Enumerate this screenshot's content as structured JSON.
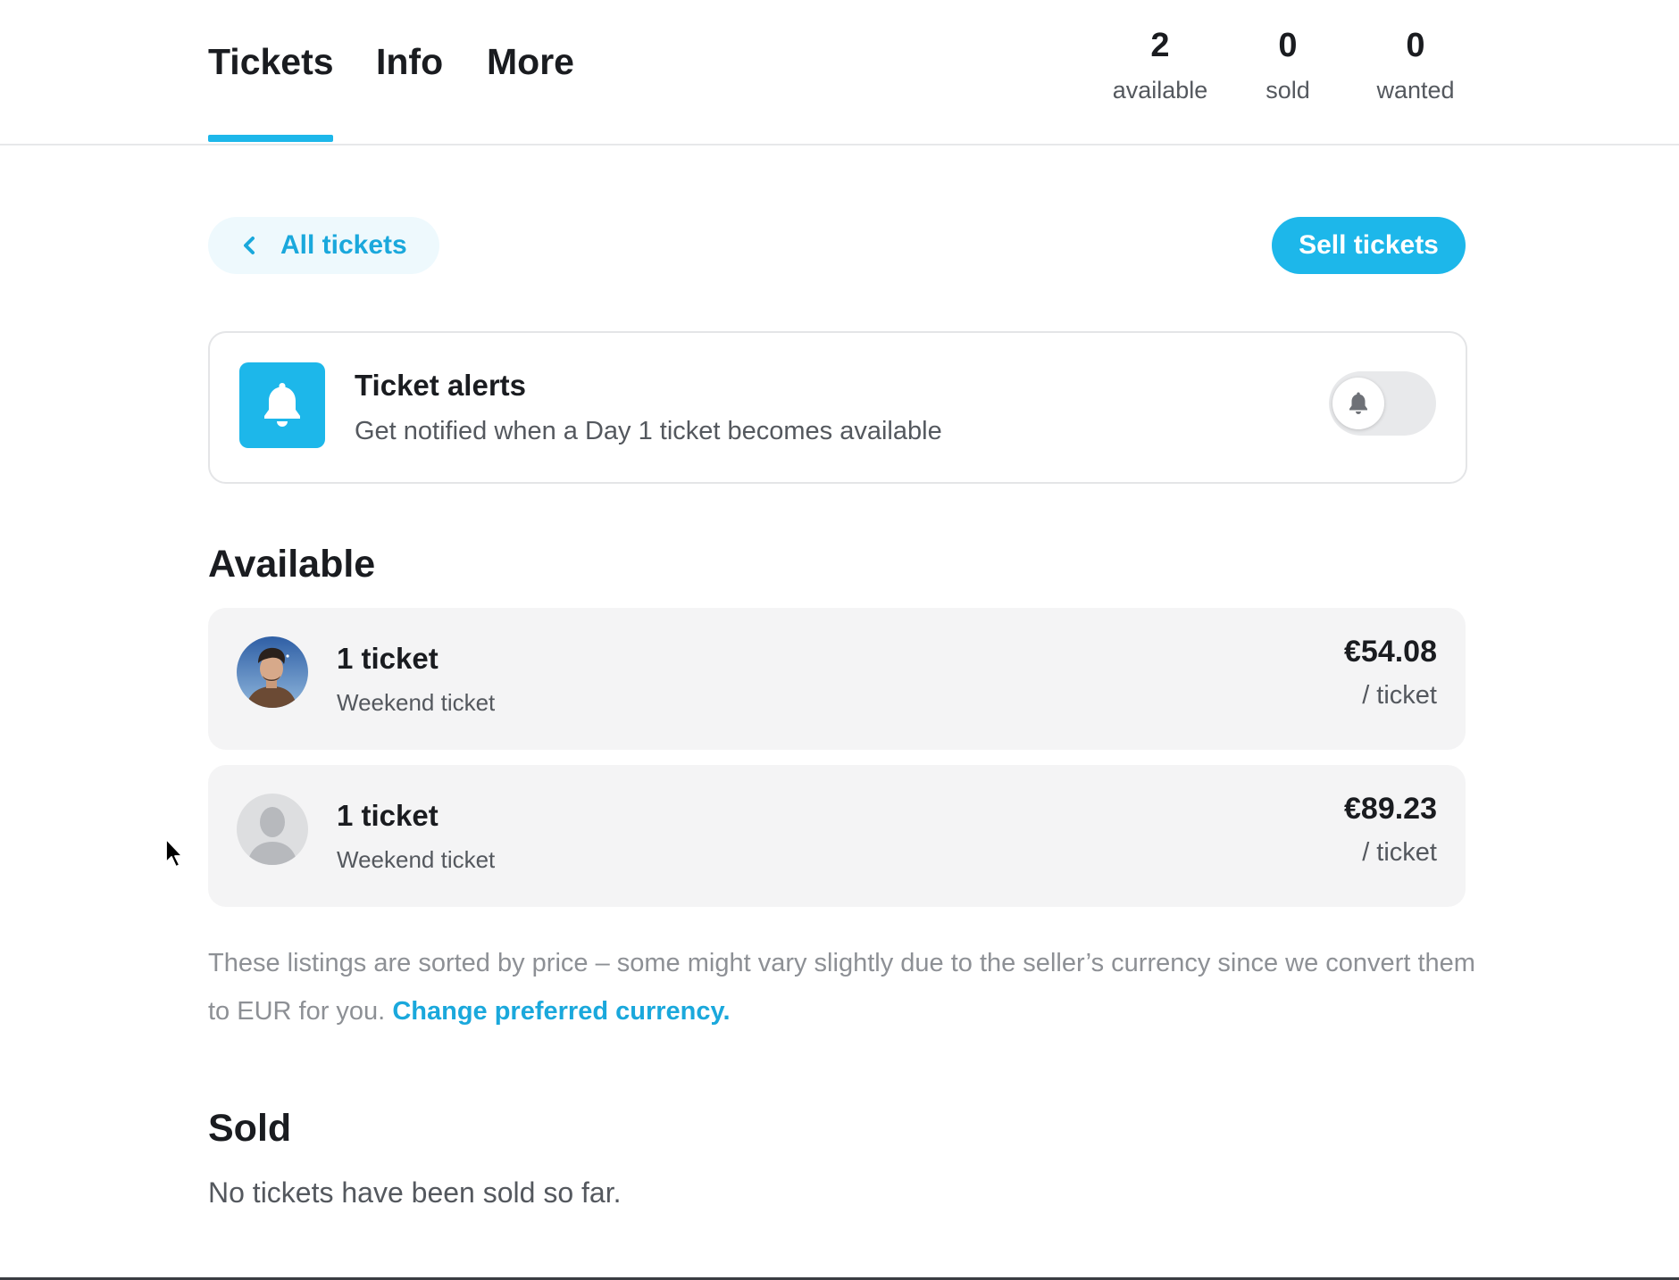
{
  "tabs": {
    "tickets": "Tickets",
    "info": "Info",
    "more": "More"
  },
  "stats": {
    "available": {
      "count": "2",
      "label": "available"
    },
    "sold": {
      "count": "0",
      "label": "sold"
    },
    "wanted": {
      "count": "0",
      "label": "wanted"
    }
  },
  "actions": {
    "back_label": "All tickets",
    "sell_label": "Sell tickets"
  },
  "alert": {
    "title": "Ticket alerts",
    "subtitle": "Get notified when a Day 1 ticket becomes available",
    "toggle_on": false
  },
  "available": {
    "heading": "Available",
    "listings": [
      {
        "qty": "1 ticket",
        "type": "Weekend ticket",
        "price": "€54.08",
        "unit": "/ ticket",
        "avatar": "photo"
      },
      {
        "qty": "1 ticket",
        "type": "Weekend ticket",
        "price": "€89.23",
        "unit": "/ ticket",
        "avatar": "placeholder"
      }
    ],
    "note_text": "These listings are sorted by price – some might vary slightly due to the seller’s currency since we convert them to EUR for you.",
    "note_link": "Change preferred currency."
  },
  "sold": {
    "heading": "Sold",
    "empty_text": "No tickets have been sold so far."
  },
  "colors": {
    "accent": "#1db7ea",
    "accent_text": "#1aa8dc",
    "card_bg": "#f4f4f5",
    "muted_text": "#8d9095"
  },
  "icons": {
    "back": "chevron-left-icon",
    "alert": "bell-icon",
    "toggle": "bell-icon",
    "placeholder_avatar": "user-silhouette-icon",
    "cursor": "mouse-pointer-icon"
  }
}
